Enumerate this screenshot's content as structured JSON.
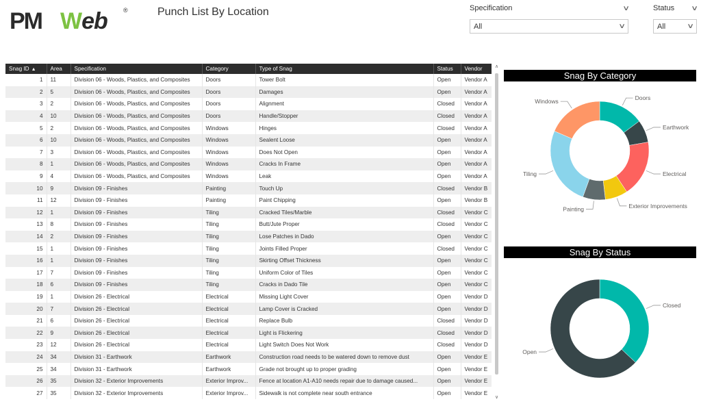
{
  "header": {
    "logo_text": "PMWeb",
    "logo_pm": "PM",
    "logo_w": "W",
    "logo_eb": "eb",
    "logo_reg": "®",
    "title": "Punch List By Location"
  },
  "filters": {
    "specification": {
      "label": "Specification",
      "value": "All"
    },
    "status": {
      "label": "Status",
      "value": "All"
    }
  },
  "table": {
    "columns": [
      "Snag ID",
      "Area",
      "Specification",
      "Category",
      "Type of Snag",
      "Status",
      "Vendor"
    ],
    "sort_column": "Snag ID",
    "rows": [
      [
        "1",
        "11",
        "Division 06 - Woods, Plastics, and Composites",
        "Doors",
        "Tower Bolt",
        "Open",
        "Vendor A"
      ],
      [
        "2",
        "5",
        "Division 06 - Woods, Plastics, and Composites",
        "Doors",
        "Damages",
        "Open",
        "Vendor A"
      ],
      [
        "3",
        "2",
        "Division 06 - Woods, Plastics, and Composites",
        "Doors",
        "Alignment",
        "Closed",
        "Vendor A"
      ],
      [
        "4",
        "10",
        "Division 06 - Woods, Plastics, and Composites",
        "Doors",
        "Handle/Stopper",
        "Closed",
        "Vendor A"
      ],
      [
        "5",
        "2",
        "Division 06 - Woods, Plastics, and Composites",
        "Windows",
        "Hinges",
        "Closed",
        "Vendor A"
      ],
      [
        "6",
        "10",
        "Division 06 - Woods, Plastics, and Composites",
        "Windows",
        "Sealent Loose",
        "Open",
        "Vendor A"
      ],
      [
        "7",
        "3",
        "Division 06 - Woods, Plastics, and Composites",
        "Windows",
        "Does Not Open",
        "Open",
        "Vendor A"
      ],
      [
        "8",
        "1",
        "Division 06 - Woods, Plastics, and Composites",
        "Windows",
        "Cracks In Frame",
        "Open",
        "Vendor A"
      ],
      [
        "9",
        "4",
        "Division 06 - Woods, Plastics, and Composites",
        "Windows",
        "Leak",
        "Open",
        "Vendor A"
      ],
      [
        "10",
        "9",
        "Division 09 - Finishes",
        "Painting",
        "Touch Up",
        "Closed",
        "Vendor B"
      ],
      [
        "11",
        "12",
        "Division 09 - Finishes",
        "Painting",
        "Paint Chipping",
        "Open",
        "Vendor B"
      ],
      [
        "12",
        "1",
        "Division 09 - Finishes",
        "Tiling",
        "Cracked Tiles/Marble",
        "Closed",
        "Vendor C"
      ],
      [
        "13",
        "8",
        "Division 09 - Finishes",
        "Tiling",
        "Butt/Jute Proper",
        "Closed",
        "Vendor C"
      ],
      [
        "14",
        "2",
        "Division 09 - Finishes",
        "Tiling",
        "Lose Patches in Dado",
        "Open",
        "Vendor C"
      ],
      [
        "15",
        "1",
        "Division 09 - Finishes",
        "Tiling",
        "Joints Filled Proper",
        "Closed",
        "Vendor C"
      ],
      [
        "16",
        "1",
        "Division 09 - Finishes",
        "Tiling",
        "Skirting Offset Thickness",
        "Open",
        "Vendor C"
      ],
      [
        "17",
        "7",
        "Division 09 - Finishes",
        "Tiling",
        "Uniform Color of Tiles",
        "Open",
        "Vendor C"
      ],
      [
        "18",
        "6",
        "Division 09 - Finishes",
        "Tiling",
        "Cracks in Dado Tile",
        "Open",
        "Vendor C"
      ],
      [
        "19",
        "1",
        "Division 26 - Electrical",
        "Electrical",
        "Missing Light Cover",
        "Open",
        "Vendor D"
      ],
      [
        "20",
        "7",
        "Division 26 - Electrical",
        "Electrical",
        "Lamp Cover is Cracked",
        "Open",
        "Vendor D"
      ],
      [
        "21",
        "6",
        "Division 26 - Electrical",
        "Electrical",
        "Replace Bulb",
        "Closed",
        "Vendor D"
      ],
      [
        "22",
        "9",
        "Division 26 - Electrical",
        "Electrical",
        "Light is Flickering",
        "Closed",
        "Vendor D"
      ],
      [
        "23",
        "12",
        "Division 26 - Electrical",
        "Electrical",
        "Light Switch Does Not Work",
        "Closed",
        "Vendor D"
      ],
      [
        "24",
        "34",
        "Division 31 - Earthwork",
        "Earthwork",
        "Construction road needs to be watered down to remove dust",
        "Open",
        "Vendor E"
      ],
      [
        "25",
        "34",
        "Division 31 - Earthwork",
        "Earthwork",
        "Grade not brought up to proper grading",
        "Open",
        "Vendor E"
      ],
      [
        "26",
        "35",
        "Division 32 - Exterior Improvements",
        "Exterior Improv...",
        "Fence at location A1-A10 needs repair due to damage caused...",
        "Open",
        "Vendor E"
      ],
      [
        "27",
        "35",
        "Division 32 - Exterior Improvements",
        "Exterior Improv...",
        "Sidewalk is not complete near south entrance",
        "Open",
        "Vendor E"
      ]
    ]
  },
  "chart_data": [
    {
      "type": "pie",
      "donut": true,
      "title": "Snag By Category",
      "categories": [
        "Doors",
        "Earthwork",
        "Electrical",
        "Exterior Improvements",
        "Painting",
        "Tiling",
        "Windows"
      ],
      "values": [
        4,
        2,
        5,
        2,
        2,
        7,
        5
      ],
      "colors": [
        "#01B8AA",
        "#374649",
        "#FD625E",
        "#F2C80F",
        "#5F6B6D",
        "#8AD4EB",
        "#FE9666"
      ]
    },
    {
      "type": "pie",
      "donut": true,
      "title": "Snag By Status",
      "categories": [
        "Closed",
        "Open"
      ],
      "values": [
        10,
        17
      ],
      "colors": [
        "#01B8AA",
        "#374649"
      ]
    }
  ]
}
